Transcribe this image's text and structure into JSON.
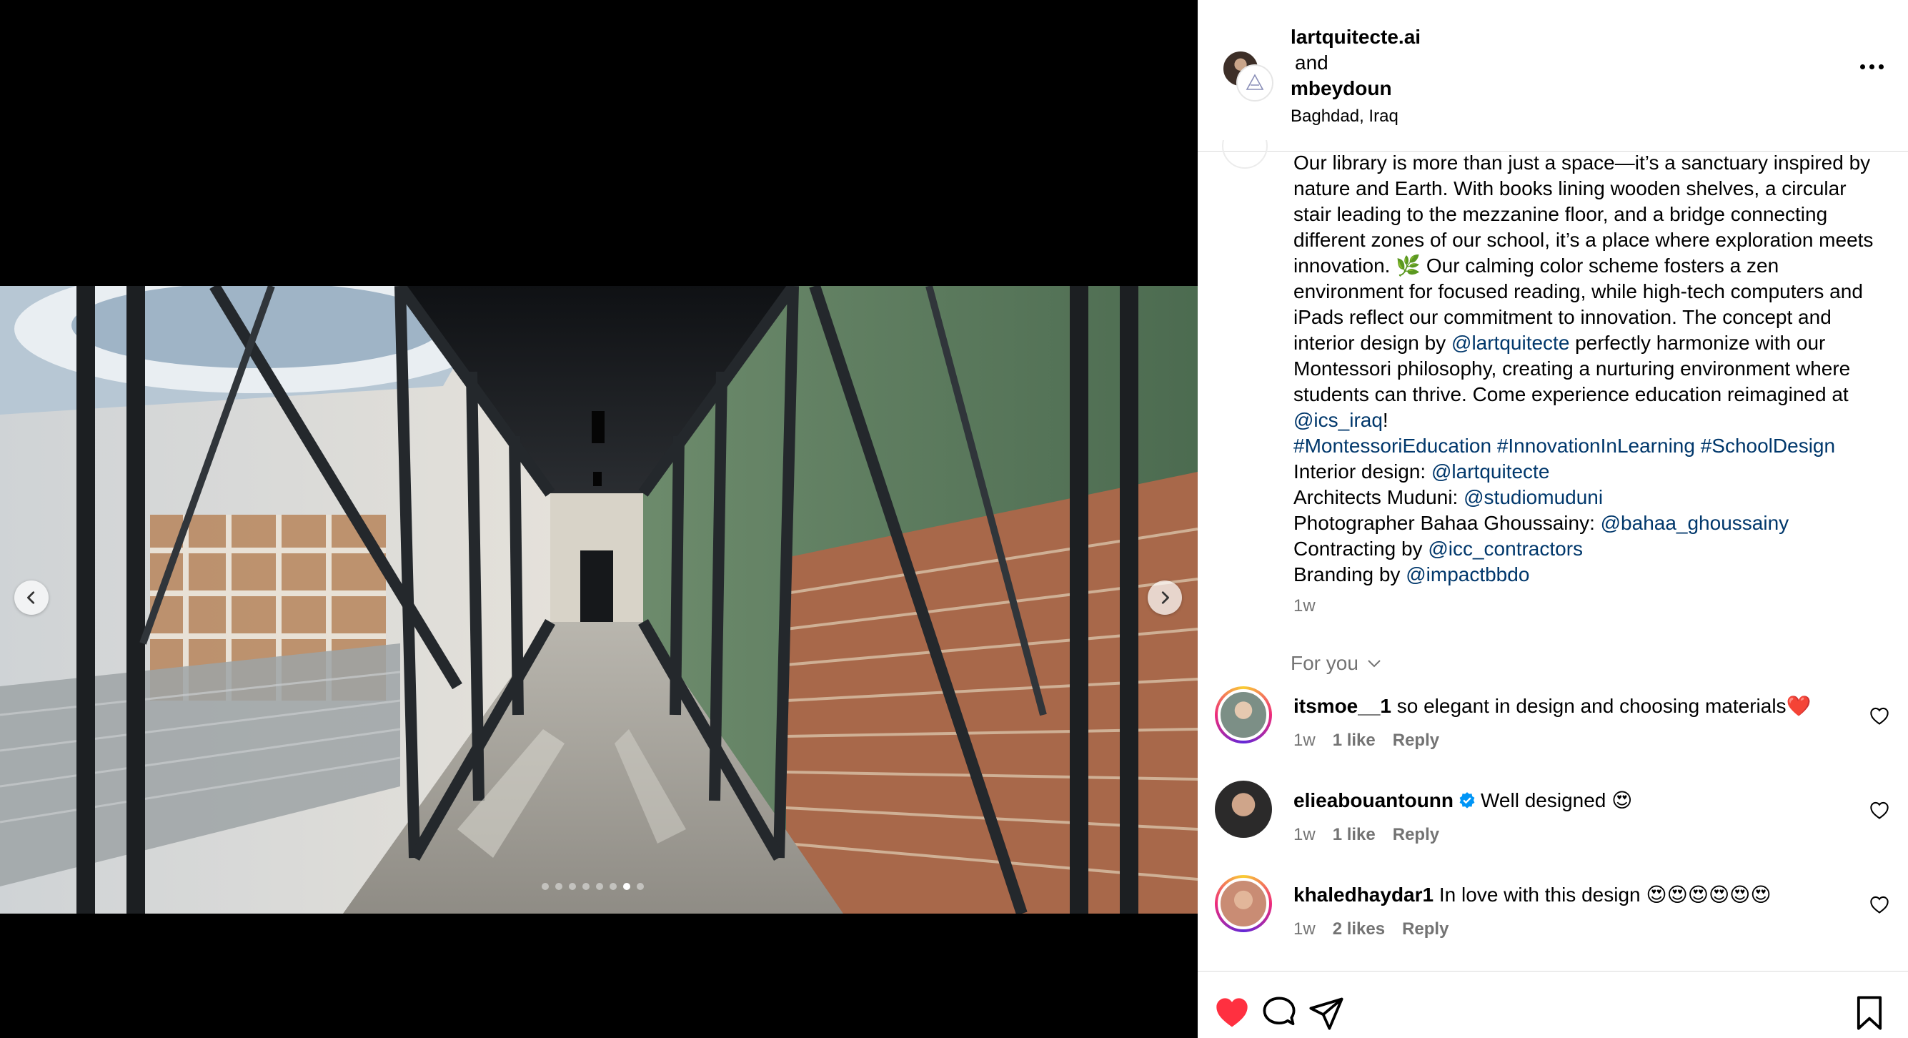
{
  "post": {
    "author": "lartquitecte.ai",
    "connector": "and",
    "coauthor": "mbeydoun",
    "location": "Baghdad, Iraq",
    "carousel": {
      "total": 8,
      "active_index": 6
    }
  },
  "caption": {
    "intro": "Our library is more than just a space—it’s a sanctuary inspired by nature and Earth. With books lining wooden shelves, a circular stair leading to the mezzanine floor, and a bridge connecting different zones of our school, it’s a place where exploration meets innovation. 🌿 Our calming color scheme fosters a zen environment for focused reading, while high-tech computers and iPads reflect our commitment to innovation. The concept and interior design by ",
    "mention1": "@lartquitecte",
    "mid": " perfectly harmonize with our Montessori philosophy, creating a nurturing environment where students can thrive. Come experience education reimagined at ",
    "mention2": "@ics_iraq",
    "exclaim": "!",
    "hashtags": "#MontessoriEducation #InnovationInLearning #SchoolDesign",
    "credits": [
      {
        "label": "Interior design: ",
        "handle": "@lartquitecte"
      },
      {
        "label": "Architects Muduni: ",
        "handle": "@studiomuduni"
      },
      {
        "label": "Photographer Bahaa Ghoussainy: ",
        "handle": "@bahaa_ghoussainy"
      },
      {
        "label": "Contracting by ",
        "handle": "@icc_contractors"
      },
      {
        "label": "Branding by ",
        "handle": "@impactbbdo"
      }
    ],
    "time": "1w"
  },
  "comments_filter": "For you",
  "comments": [
    {
      "user": "itsmoe__1",
      "text": "so elegant in design and choosing materials❤️",
      "time": "1w",
      "likes": "1 like",
      "reply": "Reply"
    },
    {
      "user": "elieabouantounn",
      "text": "Well designed 😍",
      "time": "1w",
      "likes": "1 like",
      "reply": "Reply"
    },
    {
      "user": "khaledhaydar1",
      "text": "In love with this design 😍😍😍😍😍😍",
      "time": "1w",
      "likes": "2 likes",
      "reply": "Reply"
    }
  ],
  "colors": {
    "link": "#00376b",
    "like_red": "#ff3040",
    "meta_gray": "#737373",
    "verified_blue": "#0095f6"
  },
  "icons": [
    "heart-icon",
    "comment-icon",
    "share-icon",
    "bookmark-icon",
    "more-icon",
    "chevron-left-icon",
    "chevron-right-icon",
    "chevron-down-icon",
    "verified-badge-icon"
  ]
}
